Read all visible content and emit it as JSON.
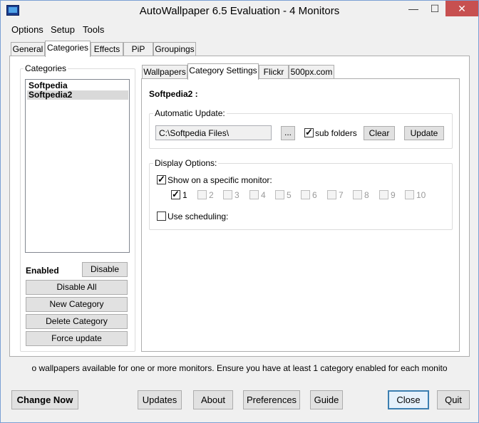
{
  "window": {
    "title": "AutoWallpaper 6.5 Evaluation - 4 Monitors"
  },
  "titlebar_buttons": {
    "minimize": "—",
    "maximize": "☐",
    "close": "✕"
  },
  "menu": [
    "Options",
    "Setup",
    "Tools"
  ],
  "main_tabs": [
    "General",
    "Categories",
    "Effects",
    "PiP",
    "Groupings"
  ],
  "categories": {
    "group_label": "Categories",
    "items": [
      "Softpedia",
      "Softpedia2"
    ],
    "selected_index": 1,
    "status_label": "Enabled",
    "disable_button": "Disable",
    "disable_all_button": "Disable All",
    "new_category_button": "New Category",
    "delete_category_button": "Delete Category",
    "force_update_button": "Force update"
  },
  "sub_tabs": [
    "Wallpapers",
    "Category Settings",
    "Flickr",
    "500px.com"
  ],
  "settings": {
    "category_name": "Softpedia2 :",
    "auto_update": {
      "label": "Automatic Update:",
      "path": "C:\\Softpedia Files\\",
      "browse_button": "...",
      "subfolders_label": "sub folders",
      "subfolders_checked": true,
      "clear_button": "Clear",
      "update_button": "Update"
    },
    "display": {
      "label": "Display Options:",
      "specific_monitor_label": "Show on a specific monitor:",
      "specific_monitor_checked": true,
      "monitors": [
        {
          "label": "1",
          "checked": true
        },
        {
          "label": "2",
          "checked": false
        },
        {
          "label": "3",
          "checked": false
        },
        {
          "label": "4",
          "checked": false
        },
        {
          "label": "5",
          "checked": false
        },
        {
          "label": "6",
          "checked": false
        },
        {
          "label": "7",
          "checked": false
        },
        {
          "label": "8",
          "checked": false
        },
        {
          "label": "9",
          "checked": false
        },
        {
          "label": "10",
          "checked": false
        }
      ],
      "scheduling_label": "Use scheduling:",
      "scheduling_checked": false
    }
  },
  "status_message": "o wallpapers available for one or more monitors. Ensure you have at least 1 category enabled for each monito",
  "bottom_buttons": {
    "change_now": "Change Now",
    "updates": "Updates",
    "about": "About",
    "preferences": "Preferences",
    "guide": "Guide",
    "close": "Close",
    "quit": "Quit"
  }
}
